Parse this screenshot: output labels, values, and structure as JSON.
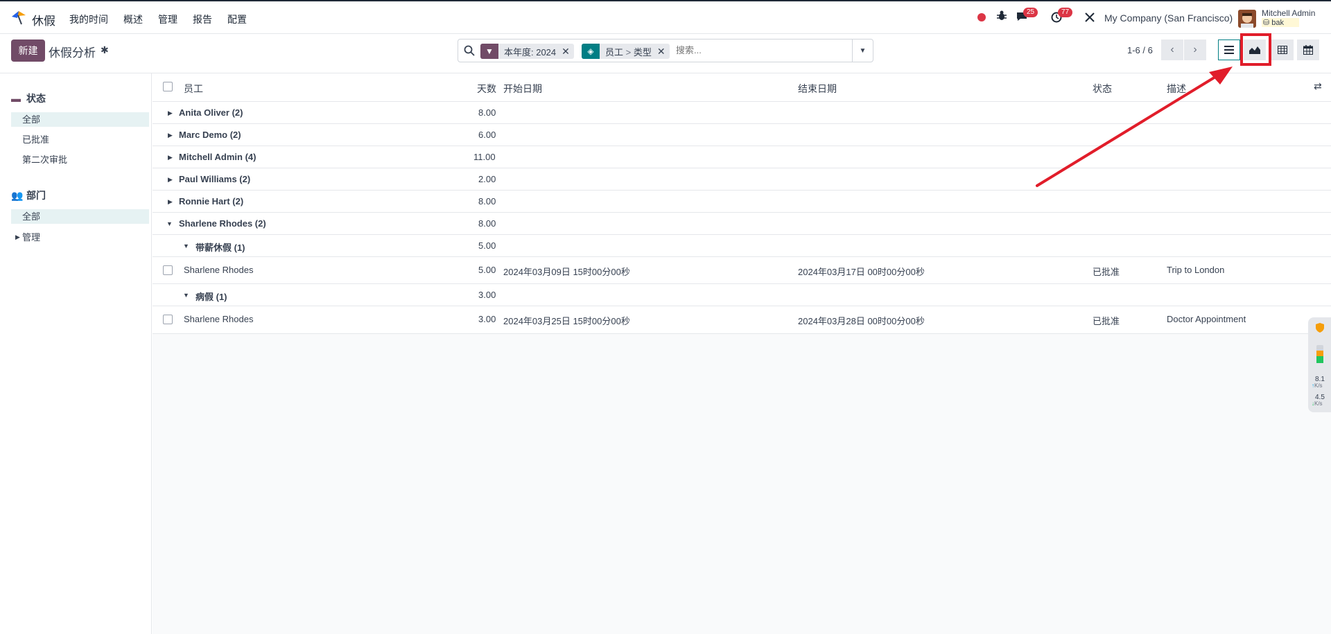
{
  "app": {
    "name": "休假",
    "menu": [
      "我的时间",
      "概述",
      "管理",
      "报告",
      "配置"
    ]
  },
  "systray": {
    "messages_count": "25",
    "activities_count": "77",
    "company": "My Company (San Francisco)",
    "user_name": "Mitchell Admin",
    "db_name": "bak"
  },
  "control": {
    "new_label": "新建",
    "title": "休假分析",
    "facets": [
      {
        "label": "本年度: 2024",
        "icon": "filter-icon"
      },
      {
        "label_a": "员工",
        "label_sep": ">",
        "label_b": "类型",
        "icon": "layers-icon"
      }
    ],
    "search_placeholder": "搜索...",
    "pager": "1-6 / 6"
  },
  "sidebar": {
    "status_title": "状态",
    "status_items": [
      "全部",
      "已批准",
      "第二次审批"
    ],
    "dept_title": "部门",
    "dept_items": [
      "全部",
      "管理"
    ]
  },
  "table": {
    "headers": {
      "employee": "员工",
      "days": "天数",
      "start": "开始日期",
      "end": "结束日期",
      "status": "状态",
      "desc": "描述"
    },
    "groups": [
      {
        "label": "Anita Oliver (2)",
        "days": "8.00"
      },
      {
        "label": "Marc Demo (2)",
        "days": "6.00"
      },
      {
        "label": "Mitchell Admin (4)",
        "days": "11.00"
      },
      {
        "label": "Paul Williams (2)",
        "days": "2.00"
      },
      {
        "label": "Ronnie Hart (2)",
        "days": "8.00"
      },
      {
        "label": "Sharlene Rhodes (2)",
        "days": "8.00"
      }
    ],
    "subgroups": [
      {
        "label": "带薪休假 (1)",
        "days": "5.00",
        "record": {
          "employee": "Sharlene Rhodes",
          "days": "5.00",
          "start": "2024年03月09日 15时00分00秒",
          "end": "2024年03月17日 00时00分00秒",
          "status": "已批准",
          "desc": "Trip to London"
        }
      },
      {
        "label": "病假 (1)",
        "days": "3.00",
        "record": {
          "employee": "Sharlene Rhodes",
          "days": "3.00",
          "start": "2024年03月25日 15时00分00秒",
          "end": "2024年03月28日 00时00分00秒",
          "status": "已批准",
          "desc": "Doctor Appointment"
        }
      }
    ]
  },
  "widget": {
    "up": "8.1",
    "up_unit": "K/s",
    "down": "4.5",
    "down_unit": "K/s"
  },
  "colors": {
    "brand": "#714b67",
    "accent": "#017e84",
    "annotation": "#e11d2a",
    "badge": "#dc3545"
  }
}
